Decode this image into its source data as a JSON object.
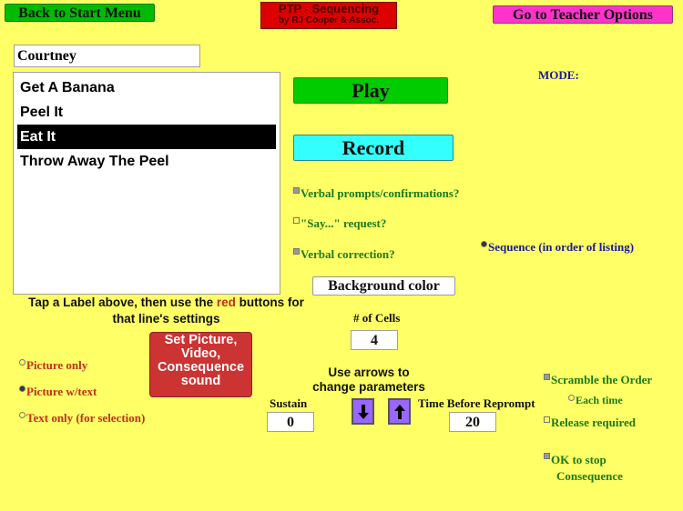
{
  "header": {
    "back_button": "Back to Start Menu",
    "app_title": "PTP - Sequencing",
    "app_subtitle": "by RJ Cooper & Assoc.",
    "teacher_button": "Go to Teacher Options"
  },
  "name_field": {
    "value": "Courtney"
  },
  "sequence_list": {
    "items": [
      {
        "label": "Get A Banana",
        "selected": false
      },
      {
        "label": "Peel It",
        "selected": false
      },
      {
        "label": "Eat It",
        "selected": true
      },
      {
        "label": "Throw Away The Peel",
        "selected": false
      }
    ]
  },
  "instructions": {
    "part1": "Tap a Label above, then use the ",
    "red_word": "red",
    "part2": " buttons for",
    "line2": "that line's settings"
  },
  "controls": {
    "play_label": "Play",
    "record_label": "Record",
    "background_color_label": "Background color",
    "set_picture_label": "Set Picture, Video, Consequence sound"
  },
  "mode": {
    "label": "MODE:",
    "sequence_option": {
      "label": "Sequence (in order of listing)",
      "checked": true
    }
  },
  "verbal_options": [
    {
      "label": "Verbal prompts/confirmations?",
      "checked": true
    },
    {
      "label": "\"Say...\" request?",
      "checked": false
    },
    {
      "label": "Verbal correction?",
      "checked": true
    }
  ],
  "display_options": [
    {
      "label": "Picture only",
      "checked": false
    },
    {
      "label": "Picture w/text",
      "checked": true
    },
    {
      "label": "Text only (for selection)",
      "checked": false
    }
  ],
  "parameters": {
    "cells_label": "# of Cells",
    "cells_value": "4",
    "arrows_hint_line1": "Use arrows to",
    "arrows_hint_line2": "change parameters",
    "sustain_label": "Sustain",
    "sustain_value": "0",
    "reprompt_label": "Time Before Reprompt",
    "reprompt_value": "20",
    "down_arrow": "down-arrow-icon",
    "up_arrow": "up-arrow-icon"
  },
  "order_options": {
    "scramble": {
      "label": "Scramble the Order",
      "checked": true
    },
    "each_time": {
      "label": "Each time",
      "checked": false
    },
    "release_required": {
      "label": "Release required",
      "checked": false
    },
    "ok_to_stop_line1": "OK to stop",
    "ok_to_stop_line2": "Consequence",
    "ok_to_stop_checked": true
  },
  "colors": {
    "background": "#ffff66",
    "play": "#00cc00",
    "record": "#33ffff",
    "title_red": "#dd0000",
    "teacher_pink": "#ff33cc",
    "set_picture_red": "#cc3333",
    "arrow_purple": "#9966ff"
  }
}
